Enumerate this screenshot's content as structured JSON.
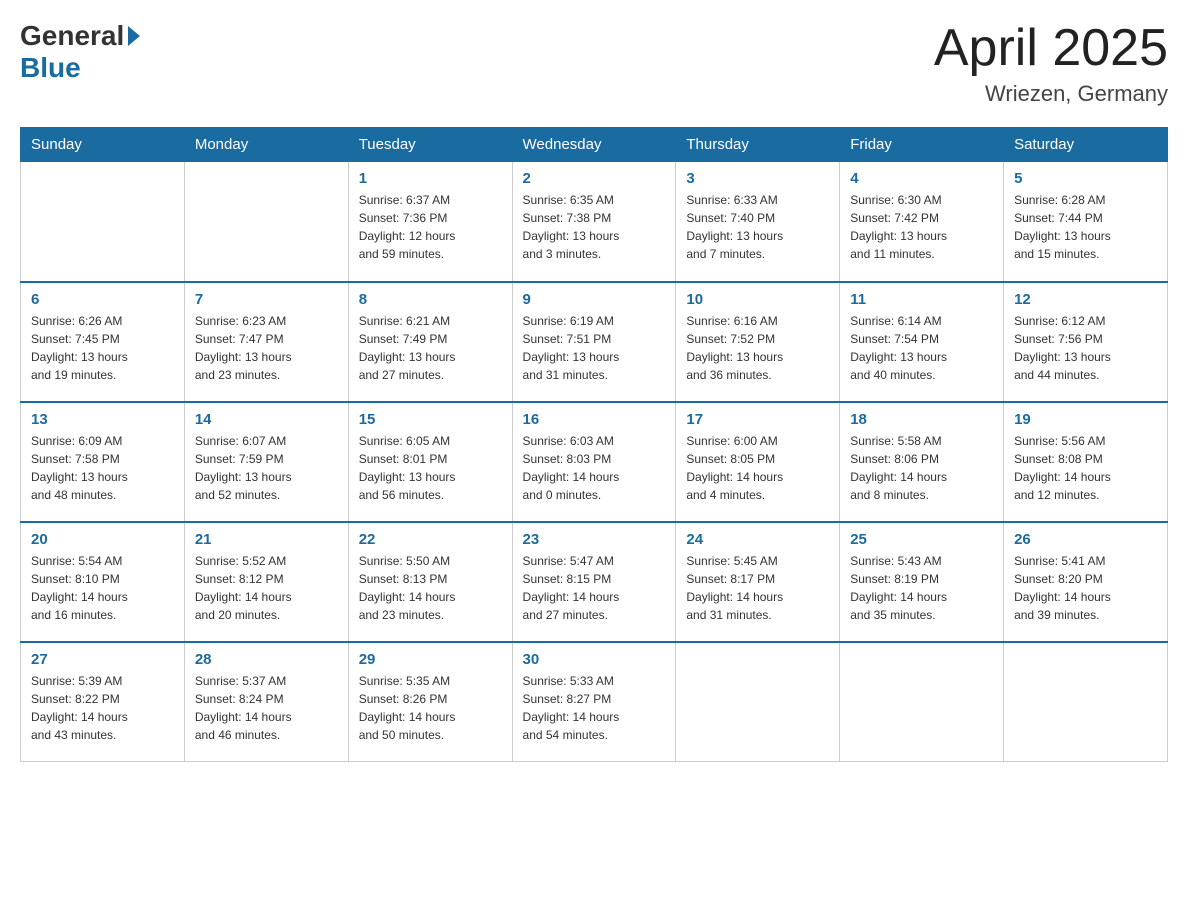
{
  "header": {
    "logo_general": "General",
    "logo_blue": "Blue",
    "month_title": "April 2025",
    "location": "Wriezen, Germany"
  },
  "days_of_week": [
    "Sunday",
    "Monday",
    "Tuesday",
    "Wednesday",
    "Thursday",
    "Friday",
    "Saturday"
  ],
  "weeks": [
    [
      {
        "day": "",
        "info": ""
      },
      {
        "day": "",
        "info": ""
      },
      {
        "day": "1",
        "info": "Sunrise: 6:37 AM\nSunset: 7:36 PM\nDaylight: 12 hours\nand 59 minutes."
      },
      {
        "day": "2",
        "info": "Sunrise: 6:35 AM\nSunset: 7:38 PM\nDaylight: 13 hours\nand 3 minutes."
      },
      {
        "day": "3",
        "info": "Sunrise: 6:33 AM\nSunset: 7:40 PM\nDaylight: 13 hours\nand 7 minutes."
      },
      {
        "day": "4",
        "info": "Sunrise: 6:30 AM\nSunset: 7:42 PM\nDaylight: 13 hours\nand 11 minutes."
      },
      {
        "day": "5",
        "info": "Sunrise: 6:28 AM\nSunset: 7:44 PM\nDaylight: 13 hours\nand 15 minutes."
      }
    ],
    [
      {
        "day": "6",
        "info": "Sunrise: 6:26 AM\nSunset: 7:45 PM\nDaylight: 13 hours\nand 19 minutes."
      },
      {
        "day": "7",
        "info": "Sunrise: 6:23 AM\nSunset: 7:47 PM\nDaylight: 13 hours\nand 23 minutes."
      },
      {
        "day": "8",
        "info": "Sunrise: 6:21 AM\nSunset: 7:49 PM\nDaylight: 13 hours\nand 27 minutes."
      },
      {
        "day": "9",
        "info": "Sunrise: 6:19 AM\nSunset: 7:51 PM\nDaylight: 13 hours\nand 31 minutes."
      },
      {
        "day": "10",
        "info": "Sunrise: 6:16 AM\nSunset: 7:52 PM\nDaylight: 13 hours\nand 36 minutes."
      },
      {
        "day": "11",
        "info": "Sunrise: 6:14 AM\nSunset: 7:54 PM\nDaylight: 13 hours\nand 40 minutes."
      },
      {
        "day": "12",
        "info": "Sunrise: 6:12 AM\nSunset: 7:56 PM\nDaylight: 13 hours\nand 44 minutes."
      }
    ],
    [
      {
        "day": "13",
        "info": "Sunrise: 6:09 AM\nSunset: 7:58 PM\nDaylight: 13 hours\nand 48 minutes."
      },
      {
        "day": "14",
        "info": "Sunrise: 6:07 AM\nSunset: 7:59 PM\nDaylight: 13 hours\nand 52 minutes."
      },
      {
        "day": "15",
        "info": "Sunrise: 6:05 AM\nSunset: 8:01 PM\nDaylight: 13 hours\nand 56 minutes."
      },
      {
        "day": "16",
        "info": "Sunrise: 6:03 AM\nSunset: 8:03 PM\nDaylight: 14 hours\nand 0 minutes."
      },
      {
        "day": "17",
        "info": "Sunrise: 6:00 AM\nSunset: 8:05 PM\nDaylight: 14 hours\nand 4 minutes."
      },
      {
        "day": "18",
        "info": "Sunrise: 5:58 AM\nSunset: 8:06 PM\nDaylight: 14 hours\nand 8 minutes."
      },
      {
        "day": "19",
        "info": "Sunrise: 5:56 AM\nSunset: 8:08 PM\nDaylight: 14 hours\nand 12 minutes."
      }
    ],
    [
      {
        "day": "20",
        "info": "Sunrise: 5:54 AM\nSunset: 8:10 PM\nDaylight: 14 hours\nand 16 minutes."
      },
      {
        "day": "21",
        "info": "Sunrise: 5:52 AM\nSunset: 8:12 PM\nDaylight: 14 hours\nand 20 minutes."
      },
      {
        "day": "22",
        "info": "Sunrise: 5:50 AM\nSunset: 8:13 PM\nDaylight: 14 hours\nand 23 minutes."
      },
      {
        "day": "23",
        "info": "Sunrise: 5:47 AM\nSunset: 8:15 PM\nDaylight: 14 hours\nand 27 minutes."
      },
      {
        "day": "24",
        "info": "Sunrise: 5:45 AM\nSunset: 8:17 PM\nDaylight: 14 hours\nand 31 minutes."
      },
      {
        "day": "25",
        "info": "Sunrise: 5:43 AM\nSunset: 8:19 PM\nDaylight: 14 hours\nand 35 minutes."
      },
      {
        "day": "26",
        "info": "Sunrise: 5:41 AM\nSunset: 8:20 PM\nDaylight: 14 hours\nand 39 minutes."
      }
    ],
    [
      {
        "day": "27",
        "info": "Sunrise: 5:39 AM\nSunset: 8:22 PM\nDaylight: 14 hours\nand 43 minutes."
      },
      {
        "day": "28",
        "info": "Sunrise: 5:37 AM\nSunset: 8:24 PM\nDaylight: 14 hours\nand 46 minutes."
      },
      {
        "day": "29",
        "info": "Sunrise: 5:35 AM\nSunset: 8:26 PM\nDaylight: 14 hours\nand 50 minutes."
      },
      {
        "day": "30",
        "info": "Sunrise: 5:33 AM\nSunset: 8:27 PM\nDaylight: 14 hours\nand 54 minutes."
      },
      {
        "day": "",
        "info": ""
      },
      {
        "day": "",
        "info": ""
      },
      {
        "day": "",
        "info": ""
      }
    ]
  ]
}
